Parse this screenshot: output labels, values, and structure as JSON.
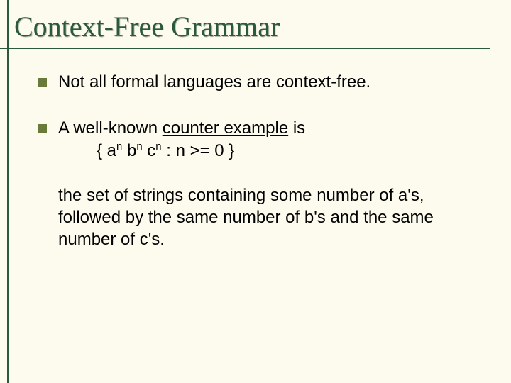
{
  "title": "Context-Free Grammar",
  "b1": {
    "text": "Not all formal languages are context-free."
  },
  "b2": {
    "lead": "A well-known ",
    "underlined": "counter example",
    "tail": " is",
    "formula": {
      "open": "{ a",
      "n1": "n",
      "mid1": " b",
      "n2": "n",
      "mid2": " c",
      "n3": "n",
      "rest": " : n >= 0  }"
    },
    "para2": "the set of strings containing some number of a's, followed by the same number of b's and the same number of c's."
  }
}
